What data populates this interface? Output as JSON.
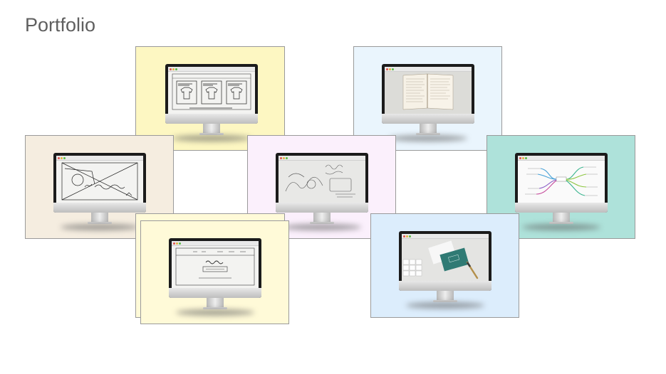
{
  "page": {
    "title": "Portfolio"
  },
  "cards": [
    {
      "id": "tshirt-sketch",
      "bg": "#fdf7c2",
      "screen": "tshirt-wireframe"
    },
    {
      "id": "notebook",
      "bg": "#eaf5fd",
      "screen": "notebook-photo"
    },
    {
      "id": "journal-sketch",
      "bg": "#f5ede0",
      "screen": "journal-sketch"
    },
    {
      "id": "apple-sketch",
      "bg": "#fbf0fc",
      "screen": "apple-sketch"
    },
    {
      "id": "mind-map",
      "bg": "#aee2da",
      "screen": "mind-map"
    },
    {
      "id": "brandwave-sketch",
      "bg": "#fffad8",
      "screen": "brandwave-wireframe"
    },
    {
      "id": "business-card",
      "bg": "#dcedfc",
      "screen": "business-card-photo"
    }
  ],
  "colors": {
    "title": "#5f5f5f",
    "border": "#9a9a9a",
    "bezel": "#1b1b1b"
  }
}
